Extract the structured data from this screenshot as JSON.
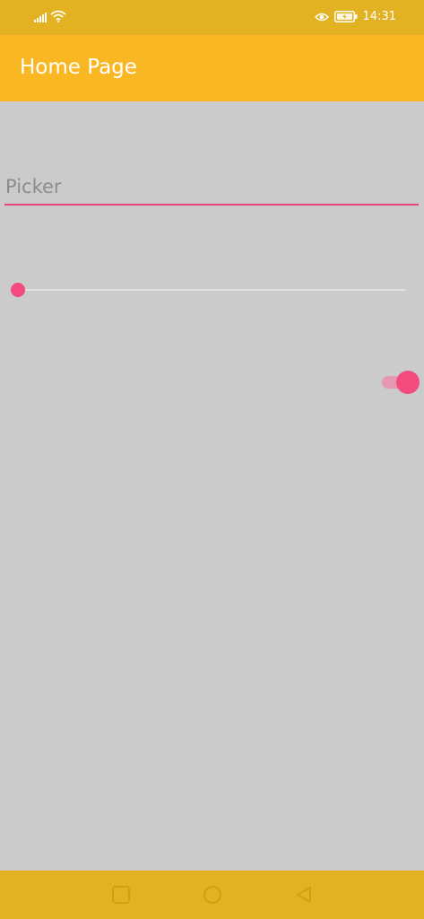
{
  "status_bar": {
    "time": "14:31",
    "icons": [
      "signal-icon",
      "wifi-icon",
      "eye-icon",
      "battery-charging-icon"
    ]
  },
  "app_bar": {
    "title": "Home Page"
  },
  "picker": {
    "placeholder": "Picker"
  },
  "slider": {
    "value_fraction": 0.0
  },
  "switch": {
    "on": true
  },
  "nav_bar": {
    "buttons": [
      "square-icon",
      "circle-icon",
      "back-triangle-icon"
    ]
  },
  "colors": {
    "status_bar": "#e3b222",
    "app_bar": "#f9b823",
    "background": "#cbcbcb",
    "accent": "#f34b7d",
    "switch_track": "#e697b2",
    "placeholder_text": "#8c8c8c"
  }
}
